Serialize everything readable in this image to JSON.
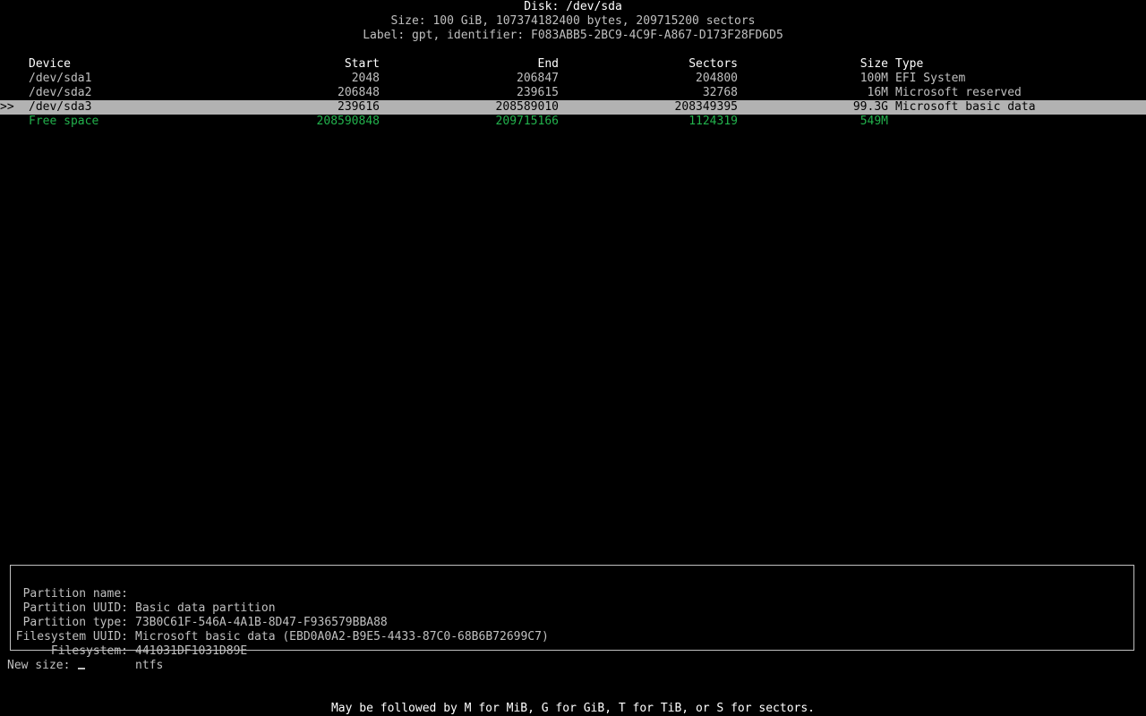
{
  "header": {
    "disk_title": "Disk: /dev/sda",
    "size_line": "Size: 100 GiB, 107374182400 bytes, 209715200 sectors",
    "label_line": "Label: gpt, identifier: F083ABB5-2BC9-4C9F-A867-D173F28FD6D5"
  },
  "table": {
    "columns": {
      "device": "Device",
      "start": "Start",
      "end": "End",
      "sectors": "Sectors",
      "size": "Size",
      "type": "Type"
    },
    "selection_marker": ">>",
    "rows": [
      {
        "device": "/dev/sda1",
        "start": "2048",
        "end": "206847",
        "sectors": "204800",
        "size": "100M",
        "type": "EFI System"
      },
      {
        "device": "/dev/sda2",
        "start": "206848",
        "end": "239615",
        "sectors": "32768",
        "size": "16M",
        "type": "Microsoft reserved"
      },
      {
        "device": "/dev/sda3",
        "start": "239616",
        "end": "208589010",
        "sectors": "208349395",
        "size": "99.3G",
        "type": "Microsoft basic data"
      },
      {
        "device": "Free space",
        "start": "208590848",
        "end": "209715166",
        "sectors": "1124319",
        "size": "549M",
        "type": ""
      }
    ]
  },
  "partition_info": {
    "name_label": "Partition name:",
    "name_value": "Basic data partition",
    "uuid_label": "Partition UUID:",
    "uuid_value": "73B0C61F-546A-4A1B-8D47-F936579BBA88",
    "type_label": "Partition type:",
    "type_value": "Microsoft basic data (EBD0A0A2-B9E5-4433-87C0-68B6B72699C7)",
    "fs_uuid_label": "Filesystem UUID:",
    "fs_uuid_value": "441031DF1031D89E",
    "fs_label": "Filesystem:",
    "fs_value": "ntfs"
  },
  "prompt": {
    "label": "New size:",
    "value": ""
  },
  "hint": "May be followed by M for MiB, G for GiB, T for TiB, or S for sectors.",
  "colors": {
    "background": "#000000",
    "text": "#c0c0c0",
    "selected_background": "#b2b2b2",
    "free_space": "#22b14c"
  }
}
